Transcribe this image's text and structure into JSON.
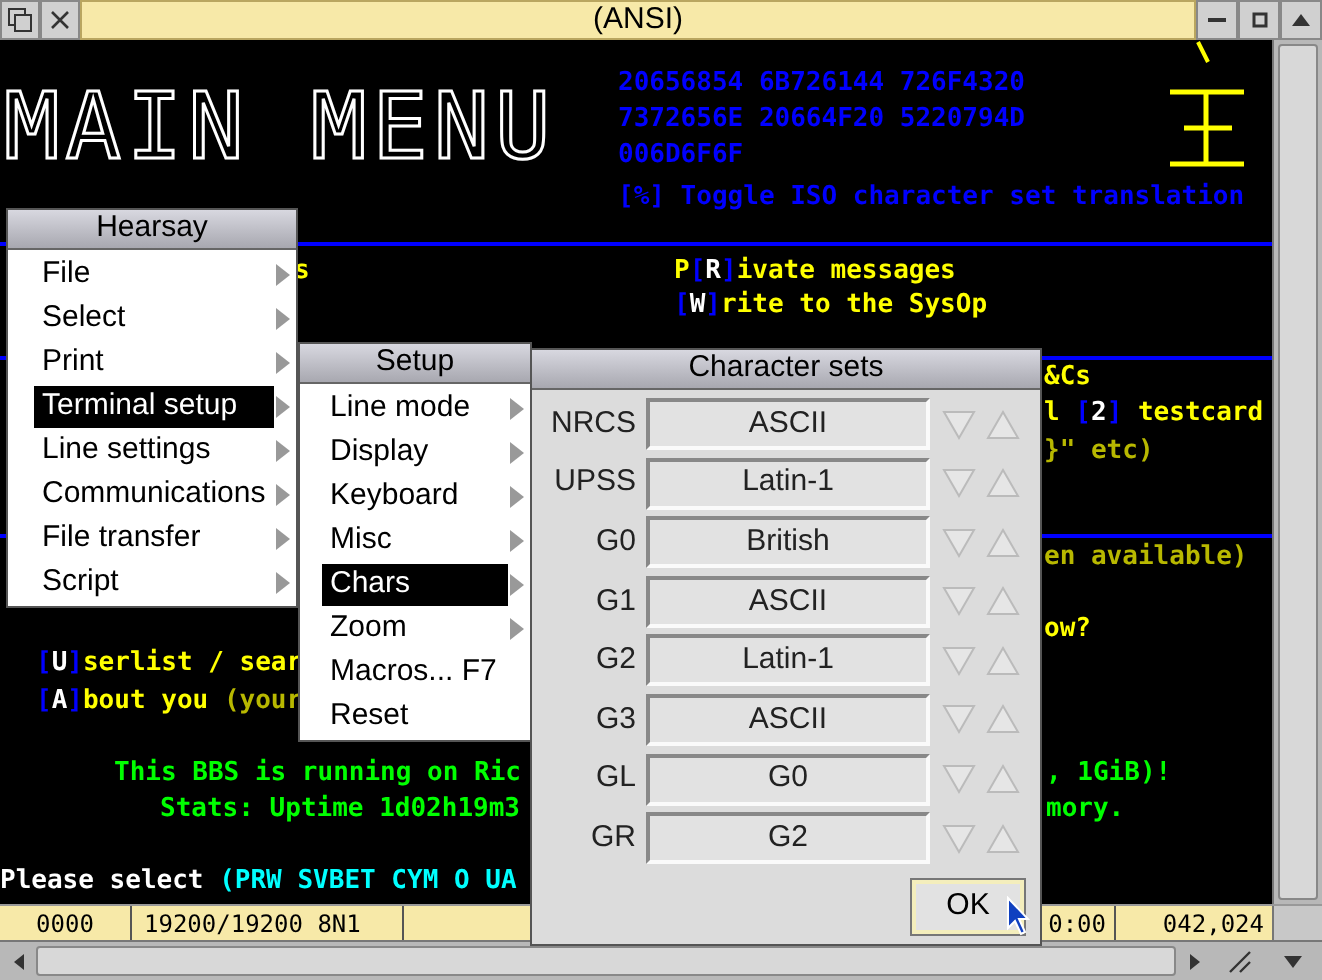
{
  "window": {
    "title": "(ANSI)"
  },
  "terminal": {
    "banner": "MAIN MENU",
    "fragments": [
      {
        "segments": [
          {
            "text": "20656854 6B726144 726F4320",
            "color": "#0000ff"
          }
        ]
      },
      {
        "segments": [
          {
            "text": "7372656E 20664F20 5220794D",
            "color": "#0000ff"
          }
        ]
      },
      {
        "segments": [
          {
            "text": "006D6F6F",
            "color": "#0000ff"
          }
        ]
      },
      {
        "segments": [
          {
            "text": "[%] Toggle ISO character set translation",
            "color": "#0000ff"
          }
        ]
      },
      {
        "segments": [
          {
            "text": "s",
            "color": "#ffff00"
          }
        ]
      },
      {
        "segments": [
          {
            "text": "P",
            "color": "#ffff00"
          },
          {
            "text": "[",
            "color": "#0000ff"
          },
          {
            "text": "R",
            "color": "#ffffff"
          },
          {
            "text": "]",
            "color": "#0000ff"
          },
          {
            "text": "ivate messages",
            "color": "#ffff00"
          }
        ]
      },
      {
        "segments": [
          {
            "text": "[",
            "color": "#0000ff"
          },
          {
            "text": "W",
            "color": "#ffffff"
          },
          {
            "text": "]",
            "color": "#0000ff"
          },
          {
            "text": "rite to the SysOp",
            "color": "#ffff00"
          }
        ]
      },
      {
        "segments": [
          {
            "text": "&Cs",
            "color": "#ffff00"
          }
        ]
      },
      {
        "segments": [
          {
            "text": "l ",
            "color": "#ffff00"
          },
          {
            "text": "[",
            "color": "#0000ff"
          },
          {
            "text": "2",
            "color": "#ffffff"
          },
          {
            "text": "]",
            "color": "#0000ff"
          },
          {
            "text": " testcard",
            "color": "#ffff00"
          }
        ]
      },
      {
        "segments": [
          {
            "text": "}\" etc)",
            "color": "#b8b800"
          }
        ]
      },
      {
        "segments": [
          {
            "text": "en available)",
            "color": "#b8b800"
          }
        ]
      },
      {
        "segments": [
          {
            "text": "ow?",
            "color": "#ffff00"
          }
        ]
      },
      {
        "segments": [
          {
            "text": "[",
            "color": "#0000ff"
          },
          {
            "text": "U",
            "color": "#ffffff"
          },
          {
            "text": "]",
            "color": "#0000ff"
          },
          {
            "text": "serlist / sear",
            "color": "#ffff00"
          }
        ]
      },
      {
        "segments": [
          {
            "text": "[",
            "color": "#0000ff"
          },
          {
            "text": "A",
            "color": "#ffffff"
          },
          {
            "text": "]",
            "color": "#0000ff"
          },
          {
            "text": "bout you ",
            "color": "#ffff00"
          },
          {
            "text": "(your",
            "color": "#b8b800"
          }
        ]
      },
      {
        "segments": [
          {
            "text": "This BBS is running on Ric",
            "color": "#00ff00"
          }
        ]
      },
      {
        "segments": [
          {
            "text": ", 1GiB)!",
            "color": "#00ff00"
          }
        ]
      },
      {
        "segments": [
          {
            "text": "Stats: Uptime 1d02h19m3",
            "color": "#00ff00"
          }
        ]
      },
      {
        "segments": [
          {
            "text": "mory.",
            "color": "#00ff00"
          }
        ]
      },
      {
        "segments": [
          {
            "text": "Please select ",
            "color": "#ffffff"
          },
          {
            "text": "(PRW SVBET CYM O UA",
            "color": "#00ffff"
          }
        ]
      }
    ]
  },
  "main_menu": {
    "title": "Hearsay",
    "items": [
      {
        "label": "File",
        "submenu": true,
        "selected": false
      },
      {
        "label": "Select",
        "submenu": true,
        "selected": false
      },
      {
        "label": "Print",
        "submenu": true,
        "selected": false
      },
      {
        "label": "Terminal setup",
        "submenu": true,
        "selected": true
      },
      {
        "label": "Line settings",
        "submenu": true,
        "selected": false
      },
      {
        "label": "Communications",
        "submenu": true,
        "selected": false
      },
      {
        "label": "File transfer",
        "submenu": true,
        "selected": false
      },
      {
        "label": "Script",
        "submenu": true,
        "selected": false
      }
    ]
  },
  "setup_menu": {
    "title": "Setup",
    "items": [
      {
        "label": "Line mode",
        "submenu": true,
        "selected": false
      },
      {
        "label": "Display",
        "submenu": true,
        "selected": false
      },
      {
        "label": "Keyboard",
        "submenu": true,
        "selected": false
      },
      {
        "label": "Misc",
        "submenu": true,
        "selected": false
      },
      {
        "label": "Chars",
        "submenu": true,
        "selected": true
      },
      {
        "label": "Zoom",
        "submenu": true,
        "selected": false
      },
      {
        "label": "Macros... F7",
        "submenu": false,
        "selected": false
      },
      {
        "label": "Reset",
        "submenu": false,
        "selected": false
      }
    ]
  },
  "dialog": {
    "title": "Character sets",
    "rows": [
      {
        "label": "NRCS",
        "value": "ASCII"
      },
      {
        "label": "UPSS",
        "value": "Latin-1"
      },
      {
        "label": "G0",
        "value": "British"
      },
      {
        "label": "G1",
        "value": "ASCII"
      },
      {
        "label": "G2",
        "value": "Latin-1"
      },
      {
        "label": "G3",
        "value": "ASCII"
      },
      {
        "label": "GL",
        "value": "G0"
      },
      {
        "label": "GR",
        "value": "G2"
      }
    ],
    "ok_button": "OK"
  },
  "status_bar": [
    "0000",
    "19200/19200 8N1",
    "0:00",
    "042,024"
  ]
}
